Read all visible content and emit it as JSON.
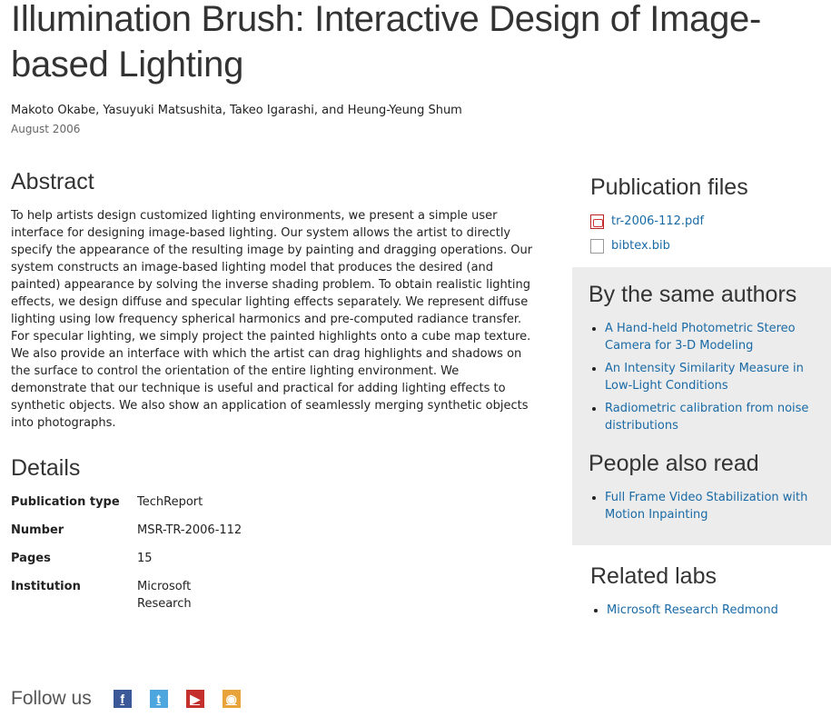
{
  "title": "Illumination Brush: Interactive Design of Image-based Lighting",
  "authors": "Makoto Okabe, Yasuyuki Matsushita, Takeo Igarashi, and Heung-Yeung Shum",
  "date": "August 2006",
  "abstract": {
    "heading": "Abstract",
    "text": "To help artists design customized lighting environments, we present a simple user interface for designing image-based lighting. Our system allows the artist to directly specify the appearance of the resulting image by painting and dragging operations. Our system constructs an image-based lighting model that produces the desired (and painted) appearance by solving the inverse shading problem. To obtain realistic lighting effects, we design diffuse and specular lighting effects separately. We represent diffuse lighting using low frequency spherical harmonics and pre-computed radiance transfer. For specular lighting, we simply project the painted highlights onto a cube map texture. We also provide an interface with which the artist can drag highlights and shadows on the surface to control the orientation of the entire lighting environment. We demonstrate that our technique is useful and practical for adding lighting effects to synthetic objects. We also show an application of seamlessly merging synthetic objects into photographs."
  },
  "details": {
    "heading": "Details",
    "rows": [
      {
        "label": "Publication type",
        "value": "TechReport"
      },
      {
        "label": "Number",
        "value": "MSR-TR-2006-112"
      },
      {
        "label": "Pages",
        "value": "15"
      },
      {
        "label": "Institution",
        "value": "Microsoft Research"
      }
    ]
  },
  "sidebar": {
    "files_heading": "Publication files",
    "files": [
      {
        "name": "tr-2006-112.pdf",
        "icon": "pdf-file-icon"
      },
      {
        "name": "bibtex.bib",
        "icon": "document-icon"
      }
    ],
    "same_authors_heading": "By the same authors",
    "same_authors": [
      "A Hand-held Photometric Stereo Camera for 3-D Modeling",
      "An Intensity Similarity Measure in Low-Light Conditions",
      "Radiometric calibration from noise distributions"
    ],
    "also_read_heading": "People also read",
    "also_read": [
      "Full Frame Video Stabilization with Motion Inpainting"
    ],
    "labs_heading": "Related labs",
    "labs": [
      "Microsoft Research Redmond"
    ]
  },
  "footer": {
    "follow_label": "Follow us",
    "social": [
      {
        "name": "facebook-icon",
        "glyph": "f",
        "color": "#3b5998"
      },
      {
        "name": "twitter-icon",
        "glyph": "t",
        "color": "#4da7de"
      },
      {
        "name": "youtube-icon",
        "glyph": "▶",
        "color": "#c4302b"
      },
      {
        "name": "rss-icon",
        "glyph": "◉",
        "color": "#e8a33a"
      }
    ]
  }
}
